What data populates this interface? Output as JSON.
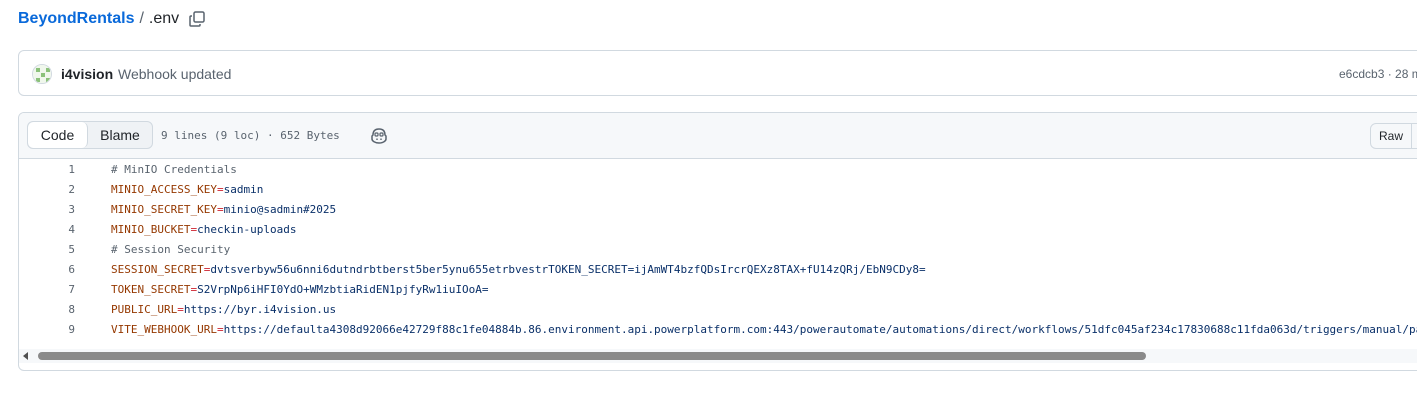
{
  "breadcrumb": {
    "repo": "BeyondRentals",
    "separator": "/",
    "file": ".env"
  },
  "commit": {
    "author": "i4vision",
    "message": "Webhook updated",
    "meta": "e6cdcb3 · 28 m"
  },
  "file_header": {
    "tabs": [
      {
        "label": "Code",
        "active": true
      },
      {
        "label": "Blame",
        "active": false
      }
    ],
    "stats": "9 lines (9 loc) · 652 Bytes",
    "raw_label": "Raw"
  },
  "code_lines": [
    {
      "num": "1",
      "type": "comment",
      "text": "# MinIO Credentials"
    },
    {
      "num": "2",
      "type": "kv",
      "key": "MINIO_ACCESS_KEY",
      "eq": "=",
      "value": "sadmin"
    },
    {
      "num": "3",
      "type": "kv",
      "key": "MINIO_SECRET_KEY",
      "eq": "=",
      "value": "minio@sadmin#2025"
    },
    {
      "num": "4",
      "type": "kv",
      "key": "MINIO_BUCKET",
      "eq": "=",
      "value": "checkin-uploads"
    },
    {
      "num": "5",
      "type": "comment",
      "text": "# Session Security"
    },
    {
      "num": "6",
      "type": "kv",
      "key": "SESSION_SECRET",
      "eq": "=",
      "value": "dvtsverbyw56u6nni6dutndrbtberst5ber5ynu655etrbvestrTOKEN_SECRET=ijAmWT4bzfQDsIrcrQEXz8TAX+fU14zQRj/EbN9CDy8="
    },
    {
      "num": "7",
      "type": "kv",
      "key": "TOKEN_SECRET",
      "eq": "=",
      "value": "S2VrpNp6iHFI0YdO+WMzbtiaRidEN1pjfyRw1iuIOoA="
    },
    {
      "num": "8",
      "type": "kv",
      "key": "PUBLIC_URL",
      "eq": "=",
      "value": "https://byr.i4vision.us"
    },
    {
      "num": "9",
      "type": "kv",
      "key": "VITE_WEBHOOK_URL",
      "eq": "=",
      "value": "https://defaulta4308d92066e42729f88c1fe04884b.86.environment.api.powerplatform.com:443/powerautomate/automations/direct/workflows/51dfc045af234c17830688c11fda063d/triggers/manual/pa"
    }
  ],
  "colors": {
    "link": "#0969da",
    "key": "#953800",
    "equals": "#cf222e",
    "value": "#0a3069",
    "comment": "#59636e"
  }
}
